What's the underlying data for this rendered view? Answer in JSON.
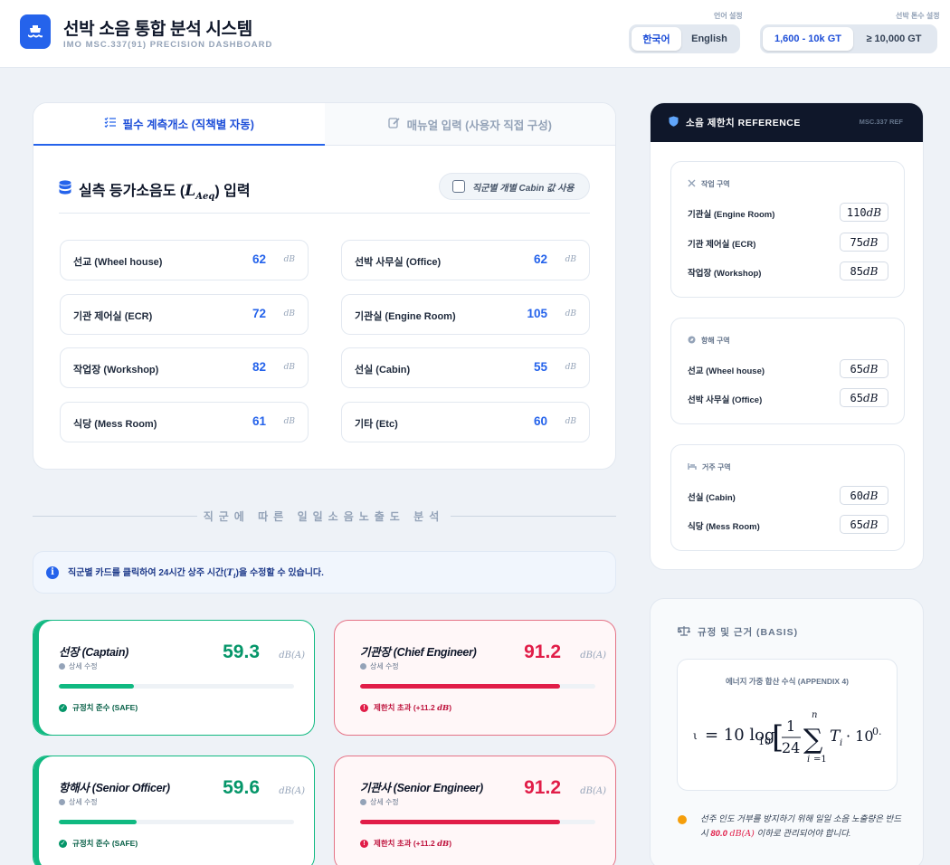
{
  "header": {
    "title": "선박 소음 통합 분석 시스템",
    "subtitle": "IMO MSC.337(91) PRECISION DASHBOARD",
    "language_label": "언어 설정",
    "languages": [
      "한국어",
      "English"
    ],
    "tonnage_label": "선박 톤수 설정",
    "tonnages": [
      "1,600 - 10k GT",
      "≥ 10,000 GT"
    ]
  },
  "input_card": {
    "tabs": [
      "필수 계측개소 (직책별 자동)",
      "매뉴얼 입력 (사용자 직접 구성)"
    ],
    "title_pre": "실측 등가소음도 (",
    "title_sym": "L",
    "title_sub": "Aeq",
    "title_post": ") 입력",
    "cabin_toggle": "직군별 개별 Cabin 값 사용",
    "unit": "dB",
    "fields": [
      {
        "label": "선교 (Wheel house)",
        "value": "62"
      },
      {
        "label": "선박 사무실 (Office)",
        "value": "62"
      },
      {
        "label": "기관 제어실 (ECR)",
        "value": "72"
      },
      {
        "label": "기관실 (Engine Room)",
        "value": "105"
      },
      {
        "label": "작업장 (Workshop)",
        "value": "82"
      },
      {
        "label": "선실 (Cabin)",
        "value": "55"
      },
      {
        "label": "식당 (Mess Room)",
        "value": "61"
      },
      {
        "label": "기타 (Etc)",
        "value": "60"
      }
    ]
  },
  "exposure": {
    "section_title": "직군에 따른 일일소음노출도 분석",
    "info_pre": "직군별 카드를 클릭하여 24시간 상주 시간(",
    "info_sym": "T",
    "info_sub": "i",
    "info_post": ")을 수정할 수 있습니다.",
    "edit_label": "상세 수정",
    "unit": "dB(A)",
    "crews": [
      {
        "name": "선장 (Captain)",
        "value": "59.3",
        "fill": 0.32,
        "status": "규정치 준수 (SAFE)",
        "state": "safe"
      },
      {
        "name": "기관장 (Chief Engineer)",
        "value": "91.2",
        "fill": 0.85,
        "status": "제한치 초과 (+11.2 ",
        "status_unit": "dB",
        "status_post": ")",
        "state": "bad"
      },
      {
        "name": "항해사 (Senior Officer)",
        "value": "59.6",
        "fill": 0.33,
        "status": "규정치 준수 (SAFE)",
        "state": "safe"
      },
      {
        "name": "기관사 (Senior Engineer)",
        "value": "91.2",
        "fill": 0.85,
        "status": "제한치 초과 (+11.2 ",
        "status_unit": "dB",
        "status_post": ")",
        "state": "bad"
      }
    ]
  },
  "reference": {
    "title": "소음 제한치 REFERENCE",
    "tag": "MSC.337 REF",
    "unit": "dB",
    "groups": [
      {
        "name": "작업 구역",
        "icon": "tools-icon",
        "rows": [
          {
            "label": "기관실 (Engine Room)",
            "value": "110"
          },
          {
            "label": "기관 제어실 (ECR)",
            "value": "75"
          },
          {
            "label": "작업장 (Workshop)",
            "value": "85"
          }
        ]
      },
      {
        "name": "항해 구역",
        "icon": "compass-icon",
        "rows": [
          {
            "label": "선교 (Wheel house)",
            "value": "65"
          },
          {
            "label": "선박 사무실 (Office)",
            "value": "65"
          }
        ]
      },
      {
        "name": "거주 구역",
        "icon": "bed-icon",
        "rows": [
          {
            "label": "선실 (Cabin)",
            "value": "60"
          },
          {
            "label": "식당 (Mess Room)",
            "value": "65"
          }
        ]
      }
    ]
  },
  "basis": {
    "title": "규정 및 근거 (BASIS)",
    "formula_title": "에너지 가중 합산 수식 (APPENDIX 4)",
    "note_pre": "선주 인도 거부를 방지하기 위해 일일 소음 노출량은 반드시 ",
    "note_value": "80.0",
    "note_unit": "dB(A)",
    "note_post": " 이하로 관리되어야 합니다."
  },
  "colors": {
    "accent": "#2563eb",
    "safe": "#10b981",
    "danger": "#e11d48",
    "dark": "#0f172a"
  }
}
